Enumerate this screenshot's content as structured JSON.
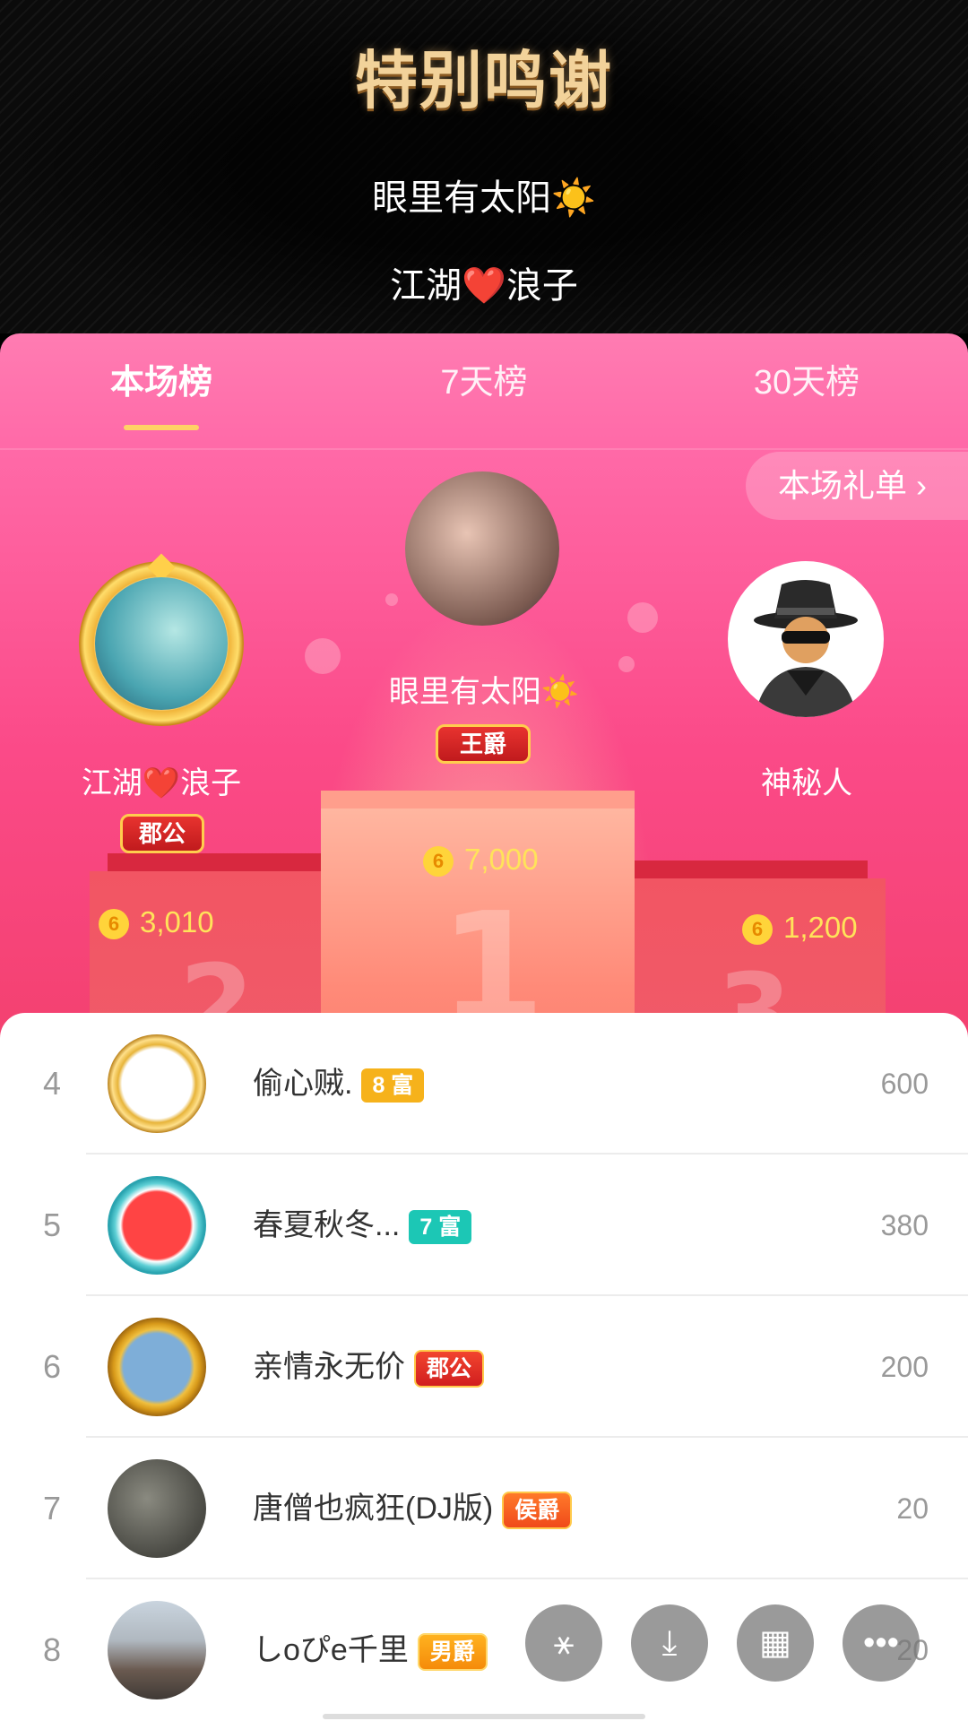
{
  "thanks": {
    "title": "特别鸣谢",
    "names": [
      "眼里有太阳☀️",
      "江湖❤️浪子"
    ]
  },
  "tabs": [
    "本场榜",
    "7天榜",
    "30天榜"
  ],
  "gift_list_button": "本场礼单 ›",
  "podium": {
    "first": {
      "name": "眼里有太阳☀️",
      "badge": "王爵",
      "score": "7,000",
      "rank_digit": "1"
    },
    "second": {
      "name": "江湖❤️浪子",
      "badge": "郡公",
      "score": "3,010",
      "rank_digit": "2"
    },
    "third": {
      "name": "神秘人",
      "score": "1,200",
      "rank_digit": "3"
    },
    "coin_symbol": "6"
  },
  "list": [
    {
      "rank": "4",
      "name": "偷心贼.",
      "tag": "8 富",
      "score": "600"
    },
    {
      "rank": "5",
      "name": "春夏秋冬...",
      "tag": "7 富",
      "score": "380"
    },
    {
      "rank": "6",
      "name": "亲情永无价",
      "tag": "郡公",
      "score": "200"
    },
    {
      "rank": "7",
      "name": "唐僧也疯狂(DJ版)",
      "tag": "侯爵",
      "score": "20"
    },
    {
      "rank": "8",
      "name": "しoぴe千里",
      "tag": "男爵",
      "score": "20"
    }
  ],
  "fabs": [
    "share-icon",
    "download-icon",
    "grid-icon",
    "more-icon"
  ],
  "fab_glyphs": [
    "⚹",
    "⤓",
    "▦",
    "•••"
  ]
}
